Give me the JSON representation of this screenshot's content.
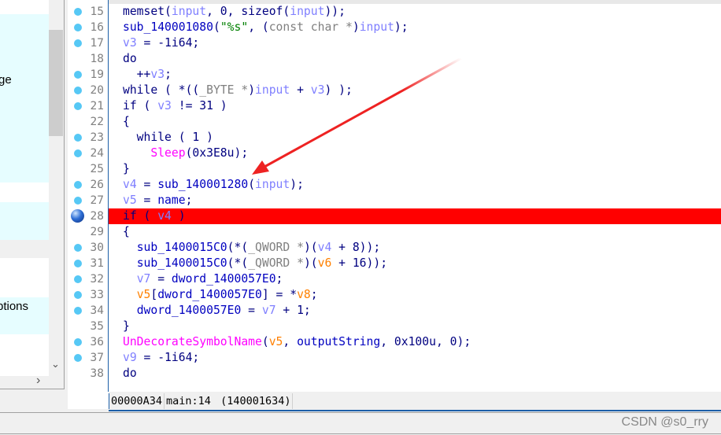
{
  "left_panel": {
    "items": [
      {
        "label": "ge"
      },
      {
        "label": "ptions"
      }
    ]
  },
  "editor": {
    "lines": [
      {
        "num": "15",
        "bp": "dot",
        "tokens": [
          [
            "k",
            "memset("
          ],
          [
            "v",
            "input"
          ],
          [
            "k",
            ", 0, sizeof("
          ],
          [
            "v",
            "input"
          ],
          [
            "k",
            "));"
          ]
        ]
      },
      {
        "num": "16",
        "bp": "dot",
        "tokens": [
          [
            "f",
            "sub_140001080"
          ],
          [
            "k",
            "("
          ],
          [
            "s",
            "\"%s\""
          ],
          [
            "k",
            ", ("
          ],
          [
            "g",
            "const char *"
          ],
          [
            "k",
            ")"
          ],
          [
            "v",
            "input"
          ],
          [
            "k",
            ");"
          ]
        ]
      },
      {
        "num": "17",
        "bp": "dot",
        "tokens": [
          [
            "v",
            "v3"
          ],
          [
            "k",
            " = -1i64;"
          ]
        ]
      },
      {
        "num": "18",
        "bp": "",
        "tokens": [
          [
            "k",
            "do"
          ]
        ]
      },
      {
        "num": "19",
        "bp": "dot",
        "tokens": [
          [
            "k",
            "  ++"
          ],
          [
            "v",
            "v3"
          ],
          [
            "k",
            ";"
          ]
        ]
      },
      {
        "num": "20",
        "bp": "dot",
        "tokens": [
          [
            "k",
            "while ( *(("
          ],
          [
            "g",
            "_BYTE *"
          ],
          [
            "k",
            ")"
          ],
          [
            "v",
            "input"
          ],
          [
            "k",
            " + "
          ],
          [
            "v",
            "v3"
          ],
          [
            "k",
            ") );"
          ]
        ]
      },
      {
        "num": "21",
        "bp": "dot",
        "tokens": [
          [
            "k",
            "if ( "
          ],
          [
            "v",
            "v3"
          ],
          [
            "k",
            " != 31 )"
          ]
        ]
      },
      {
        "num": "22",
        "bp": "",
        "tokens": [
          [
            "k",
            "{"
          ]
        ]
      },
      {
        "num": "23",
        "bp": "dot",
        "tokens": [
          [
            "k",
            "  while ( 1 )"
          ]
        ]
      },
      {
        "num": "24",
        "bp": "dot",
        "tokens": [
          [
            "k",
            "    "
          ],
          [
            "m",
            "Sleep"
          ],
          [
            "k",
            "(0x3E8u);"
          ]
        ]
      },
      {
        "num": "25",
        "bp": "",
        "tokens": [
          [
            "k",
            "}"
          ]
        ]
      },
      {
        "num": "26",
        "bp": "dot",
        "tokens": [
          [
            "v",
            "v4"
          ],
          [
            "k",
            " = "
          ],
          [
            "f",
            "sub_140001280"
          ],
          [
            "k",
            "("
          ],
          [
            "v",
            "input"
          ],
          [
            "k",
            ");"
          ]
        ]
      },
      {
        "num": "27",
        "bp": "dot",
        "tokens": [
          [
            "v",
            "v5"
          ],
          [
            "k",
            " = "
          ],
          [
            "f",
            "name"
          ],
          [
            "k",
            ";"
          ]
        ]
      },
      {
        "num": "28",
        "bp": "breakpoint",
        "highlight": true,
        "tokens": [
          [
            "k",
            "if ( "
          ],
          [
            "v",
            "v4"
          ],
          [
            "k",
            " )"
          ]
        ]
      },
      {
        "num": "29",
        "bp": "",
        "tokens": [
          [
            "k",
            "{"
          ]
        ]
      },
      {
        "num": "30",
        "bp": "dot",
        "tokens": [
          [
            "k",
            "  "
          ],
          [
            "f",
            "sub_1400015C0"
          ],
          [
            "k",
            "(*("
          ],
          [
            "g",
            "_QWORD *"
          ],
          [
            "k",
            ")("
          ],
          [
            "v",
            "v4"
          ],
          [
            "k",
            " + 8));"
          ]
        ]
      },
      {
        "num": "31",
        "bp": "dot",
        "tokens": [
          [
            "k",
            "  "
          ],
          [
            "f",
            "sub_1400015C0"
          ],
          [
            "k",
            "(*("
          ],
          [
            "g",
            "_QWORD *"
          ],
          [
            "k",
            ")("
          ],
          [
            "o",
            "v6"
          ],
          [
            "k",
            " + 16));"
          ]
        ]
      },
      {
        "num": "32",
        "bp": "dot",
        "tokens": [
          [
            "k",
            "  "
          ],
          [
            "v",
            "v7"
          ],
          [
            "k",
            " = "
          ],
          [
            "f",
            "dword_1400057E0"
          ],
          [
            "k",
            ";"
          ]
        ]
      },
      {
        "num": "33",
        "bp": "dot",
        "tokens": [
          [
            "k",
            "  "
          ],
          [
            "o",
            "v5"
          ],
          [
            "k",
            "["
          ],
          [
            "f",
            "dword_1400057E0"
          ],
          [
            "k",
            "] = *"
          ],
          [
            "o",
            "v8"
          ],
          [
            "k",
            ";"
          ]
        ]
      },
      {
        "num": "34",
        "bp": "dot",
        "tokens": [
          [
            "k",
            "  "
          ],
          [
            "f",
            "dword_1400057E0"
          ],
          [
            "k",
            " = "
          ],
          [
            "v",
            "v7"
          ],
          [
            "k",
            " + 1;"
          ]
        ]
      },
      {
        "num": "35",
        "bp": "",
        "tokens": [
          [
            "k",
            "}"
          ]
        ]
      },
      {
        "num": "36",
        "bp": "dot",
        "tokens": [
          [
            "m",
            "UnDecorateSymbolName"
          ],
          [
            "k",
            "("
          ],
          [
            "o",
            "v5"
          ],
          [
            "k",
            ", "
          ],
          [
            "f",
            "outputString"
          ],
          [
            "k",
            ", 0x100u, 0);"
          ]
        ]
      },
      {
        "num": "37",
        "bp": "dot",
        "tokens": [
          [
            "v",
            "v9"
          ],
          [
            "k",
            " = -1i64;"
          ]
        ]
      },
      {
        "num": "38",
        "bp": "",
        "tokens": [
          [
            "k",
            "do"
          ]
        ]
      }
    ]
  },
  "status": {
    "offset": "00000A34",
    "location": "main:14",
    "address": "(140001634)"
  },
  "watermark": "CSDN @s0_rry",
  "colors": {
    "highlight": "#ff0000",
    "arrow": "#ee2222",
    "accent": "#1c5fa8"
  }
}
